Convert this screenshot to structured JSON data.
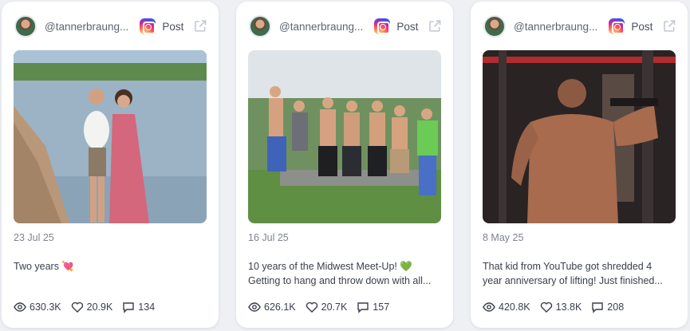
{
  "posts": [
    {
      "handle": "@tannerbraung...",
      "platform_icon": "instagram-icon",
      "post_label": "Post",
      "date": "23 Jul 25",
      "caption_lines": [
        "Two years 💘",
        ""
      ],
      "views": "630.3K",
      "likes": "20.9K",
      "comments": "134"
    },
    {
      "handle": "@tannerbraung...",
      "platform_icon": "instagram-icon",
      "post_label": "Post",
      "date": "16 Jul 25",
      "caption_lines": [
        "10 years of the Midwest Meet-Up! 💚",
        "Getting to hang and throw down with all..."
      ],
      "views": "626.1K",
      "likes": "20.7K",
      "comments": "157"
    },
    {
      "handle": "@tannerbraung...",
      "platform_icon": "instagram-icon",
      "post_label": "Post",
      "date": "8 May 25",
      "caption_lines": [
        "That kid from YouTube got shredded 4",
        "year anniversary of lifting! Just finished..."
      ],
      "views": "420.8K",
      "likes": "13.8K",
      "comments": "208"
    }
  ],
  "colors": {
    "card_bg": "#ffffff",
    "page_bg": "#eef0f4",
    "muted_text": "#7d8390",
    "icon_grey": "#c3c7cf"
  }
}
